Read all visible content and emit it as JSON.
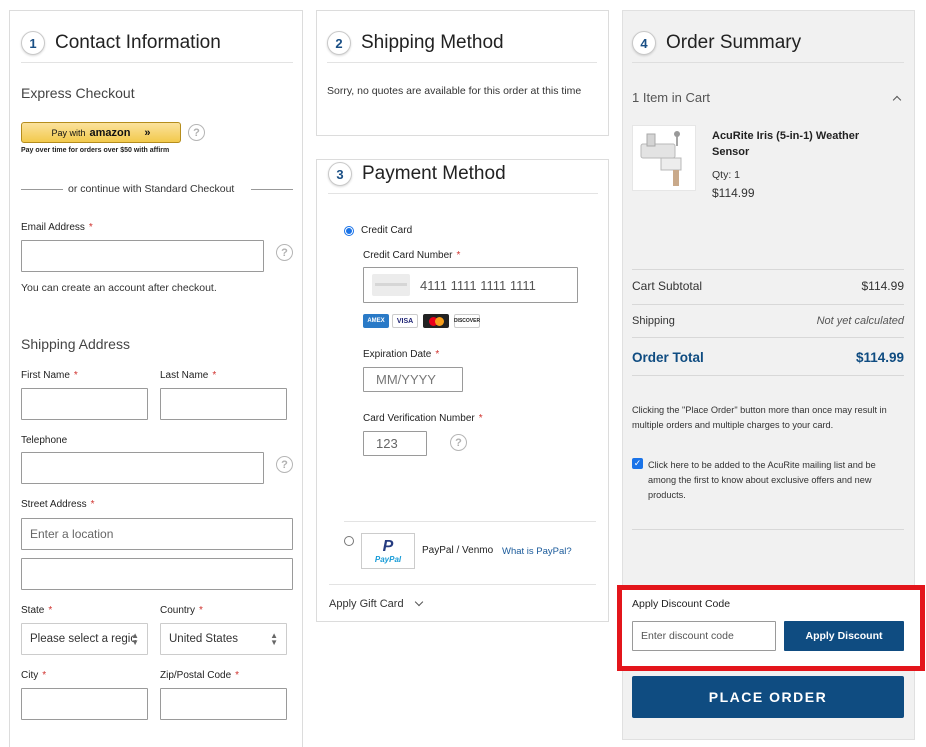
{
  "contact": {
    "step": "1",
    "title": "Contact Information",
    "express_checkout": "Express Checkout",
    "amazon_pay_label": "Pay with",
    "amazon_brand": "amazon",
    "affirm_text": "Pay over time for orders over $50 with",
    "affirm_brand": "affirm",
    "continue_text": "or continue with Standard Checkout",
    "email_label": "Email Address",
    "email_value": "",
    "account_note": "You can create an account after checkout.",
    "shipping_address": "Shipping Address",
    "first_name_label": "First Name",
    "last_name_label": "Last Name",
    "telephone_label": "Telephone",
    "street_label": "Street Address",
    "street_placeholder": "Enter a location",
    "state_label": "State",
    "state_value": "Please select a regic",
    "country_label": "Country",
    "country_value": "United States",
    "city_label": "City",
    "zip_label": "Zip/Postal Code",
    "required_mark": "*",
    "help_glyph": "?"
  },
  "shipping": {
    "step": "2",
    "title": "Shipping Method",
    "message": "Sorry, no quotes are available for this order at this time"
  },
  "payment": {
    "step": "3",
    "title": "Payment Method",
    "credit_card_option": "Credit Card",
    "cc_number_label": "Credit Card Number",
    "cc_number_value": "4111 1111 1111 1111",
    "card_brands": [
      "AMEX",
      "VISA",
      "MC",
      "DISCOVER"
    ],
    "expiration_label": "Expiration Date",
    "expiration_placeholder": "MM/YYYY",
    "cvv_label": "Card Verification Number",
    "cvv_value": "123",
    "paypal_option": "PayPal / Venmo",
    "paypal_brand": "PayPal",
    "what_is_paypal": "What is PayPal?",
    "gift_card": "Apply Gift Card"
  },
  "summary": {
    "step": "4",
    "title": "Order Summary",
    "items_in_cart": "1 Item in Cart",
    "product_name": "AcuRite Iris (5-in-1) Weather Sensor",
    "qty_label": "Qty: 1",
    "product_price": "$114.99",
    "cart_subtotal_label": "Cart Subtotal",
    "cart_subtotal_value": "$114.99",
    "shipping_label": "Shipping",
    "shipping_value": "Not yet calculated",
    "order_total_label": "Order Total",
    "order_total_value": "$114.99",
    "warning": "Clicking the \"Place Order\" button more than once may result in multiple orders and multiple charges to your card.",
    "mailing_list": "Click here to be added to the AcuRite mailing list and be among the first to know about exclusive offers and new products.",
    "discount_title": "Apply Discount Code",
    "discount_placeholder": "Enter discount code",
    "apply_discount": "Apply Discount",
    "place_order": "PLACE ORDER"
  },
  "colors": {
    "brand_blue": "#0f4c81",
    "highlight_red": "#e3151b",
    "amazon_yellow": "#f7d774"
  }
}
